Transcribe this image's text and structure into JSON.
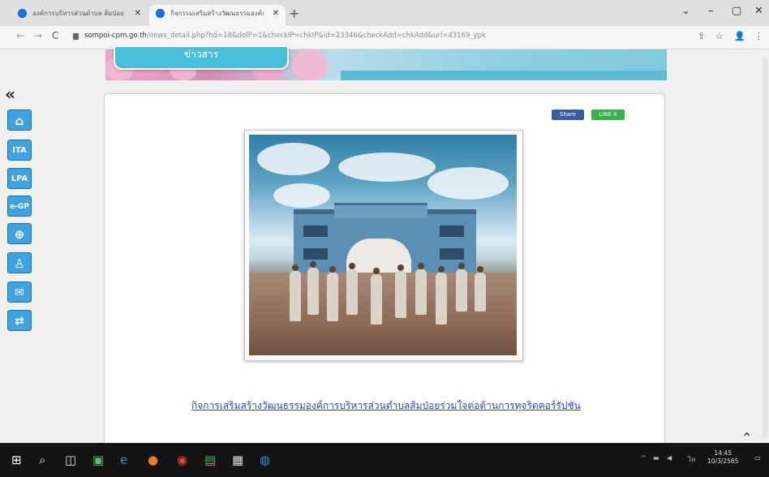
{
  "browser": {
    "tabs": [
      {
        "title": "องค์การบริหารส่วนตำบล ส้มป่อย อ.ราษีไศล",
        "close": "✕"
      },
      {
        "title": "กิจกรรมเสริมสร้างวัฒนธรรมองค์กร",
        "close": "✕"
      }
    ],
    "new_tab": "+",
    "window_controls": [
      "⌄",
      "–",
      "▢",
      "✕"
    ],
    "nav": {
      "back": "←",
      "forward": "→",
      "reload": "C"
    },
    "url_host": "sompoi-cpm.go.th",
    "url_path": "/news_detail.php?hd=18&doIP=1&checkIP=chkIP&id=23346&checkAdd=chkAdd&url=43169_ypk",
    "toolbar_icons": [
      "⇪",
      "☆",
      "👤",
      "⋮"
    ]
  },
  "page": {
    "banner_tab_label": "ข่าวสาร",
    "share_label": "Share",
    "chat_label": "LINE it",
    "headline": "กิจการเสริมสร้างวัฒนธรรมองค์การบริหารส่วนตำบลส้มป่อยร่วมใจต่อต้านการทุจริตคอร์รัปชัน"
  },
  "sidebar": {
    "collapse": "«",
    "items": [
      {
        "label": "⌂",
        "name": "home"
      },
      {
        "label": "ITA",
        "name": "ita"
      },
      {
        "label": "LPA",
        "name": "lpa"
      },
      {
        "label": "e-GP",
        "name": "egp"
      },
      {
        "label": "⊕",
        "name": "globe"
      },
      {
        "label": "♙",
        "name": "person"
      },
      {
        "label": "✉",
        "name": "mail"
      },
      {
        "label": "⇄",
        "name": "translate"
      }
    ]
  },
  "taskbar": {
    "time": "14:45",
    "date": "10/3/2565",
    "lang": "ไท"
  }
}
